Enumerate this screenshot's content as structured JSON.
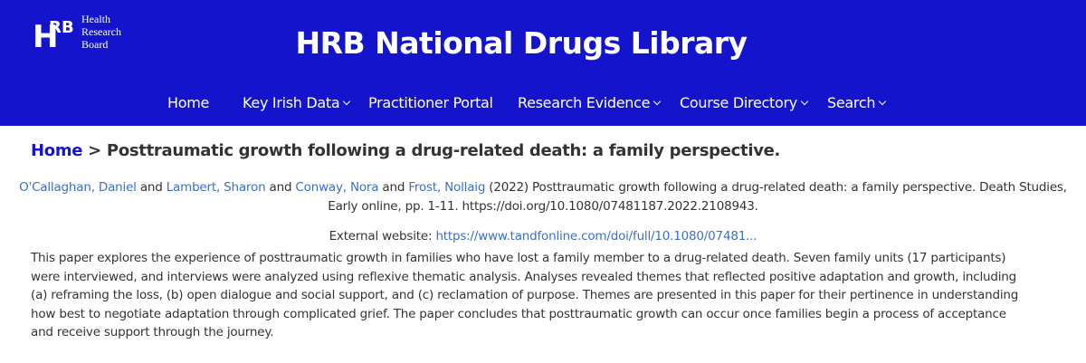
{
  "header": {
    "logo_mark": {
      "h": "H",
      "r": "R",
      "b": "B"
    },
    "logo_lines": [
      "Health",
      "Research",
      "Board"
    ],
    "site_title": "HRB National Drugs Library",
    "nav": [
      {
        "label": "Home",
        "dropdown": false
      },
      {
        "label": "Key Irish Data",
        "dropdown": true
      },
      {
        "label": "Practitioner Portal",
        "dropdown": false
      },
      {
        "label": "Research Evidence",
        "dropdown": true
      },
      {
        "label": "Course Directory",
        "dropdown": true
      },
      {
        "label": "Search",
        "dropdown": true
      }
    ]
  },
  "breadcrumb": {
    "home": "Home",
    "separator": " > ",
    "current": "Posttraumatic growth following a drug-related death: a family perspective."
  },
  "citation": {
    "authors": [
      "O'Callaghan, Daniel",
      "Lambert, Sharon",
      "Conway, Nora",
      "Frost, Nollaig"
    ],
    "and": " and ",
    "rest": " (2022) Posttraumatic growth following a drug-related death: a family perspective. Death Studies, Early online, pp. 1-11. https://doi.org/10.1080/07481187.2022.2108943."
  },
  "external": {
    "label": "External website: ",
    "url": "https://www.tandfonline.com/doi/full/10.1080/07481..."
  },
  "abstract": "This paper explores the experience of posttraumatic growth in families who have lost a family member to a drug-related death. Seven family units (17 participants) were interviewed, and interviews were analyzed using reflexive thematic analysis. Analyses revealed themes that reflected positive adaptation and growth, including (a) reframing the loss, (b) open dialogue and social support, and (c) reclamation of purpose. Themes are presented in this paper for their pertinence in understanding how best to negotiate adaptation through complicated grief. The paper concludes that posttraumatic growth can occur once families begin a process of acceptance and receive support through the journey.",
  "colors": {
    "header_bg": "#1414cc",
    "link": "#3b6fc9",
    "home_link": "#1414cc",
    "text": "#333333"
  }
}
